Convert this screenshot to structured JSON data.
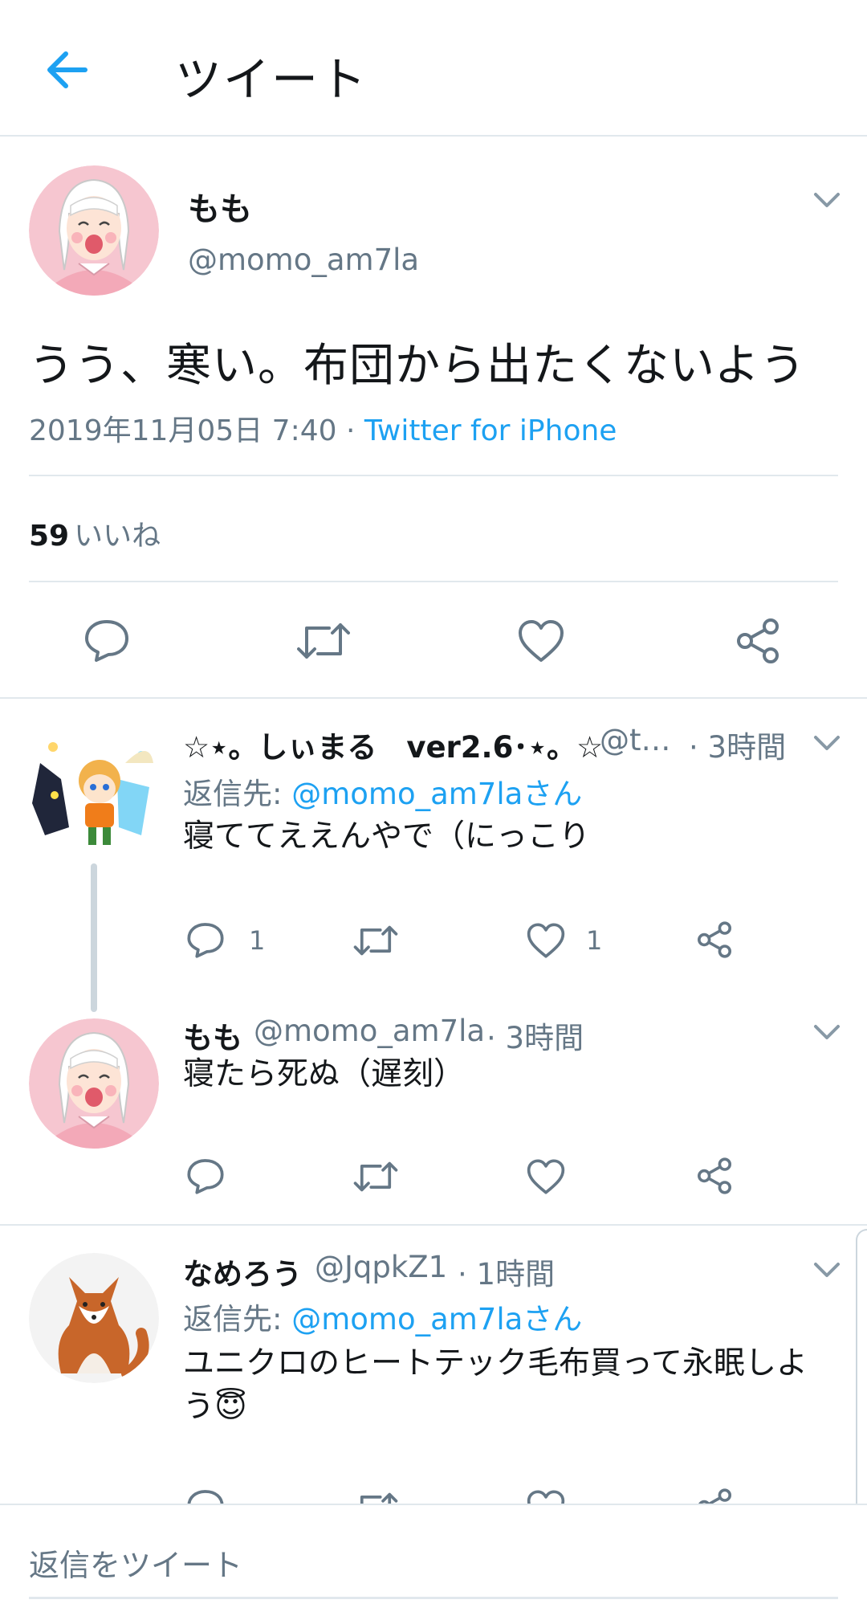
{
  "header": {
    "title": "ツイート",
    "back_icon": "arrow-left-icon"
  },
  "main_tweet": {
    "name": "もも",
    "handle": "@momo_am7la",
    "text": "うう、寒い。布団から出たくないよう",
    "date": "2019年11月05日 7:40",
    "separator": " · ",
    "source": "Twitter for iPhone",
    "likes_count": "59",
    "likes_label": "いいね"
  },
  "replies": [
    {
      "name": "☆⋆。しぃまる　ver2.6･⋆。☆",
      "handle": "@t…",
      "time": "· 3時間",
      "reply_label": "返信先: ",
      "reply_to": "@momo_am7laさん",
      "text": "寝ててええんやで（にっこり",
      "reply_count": "1",
      "like_count": "1"
    },
    {
      "name": "もも",
      "handle": "@momo_am7la",
      "time": "· 3時間",
      "text": "寝たら死ぬ（遅刻）"
    },
    {
      "name": "なめろう",
      "handle": "@JqpkZ1",
      "time": "· 1時間",
      "reply_label": "返信先: ",
      "reply_to": "@momo_am7laさん",
      "text_line1": "ユニクロのヒートテック毛布買って永眠しよ",
      "text_line2": "う",
      "emoji": "😇"
    }
  ],
  "composer": {
    "placeholder": "返信をツイート"
  },
  "colors": {
    "accent": "#1da1f2",
    "muted": "#657786",
    "divider": "#e1e8ed",
    "text": "#14171a"
  }
}
